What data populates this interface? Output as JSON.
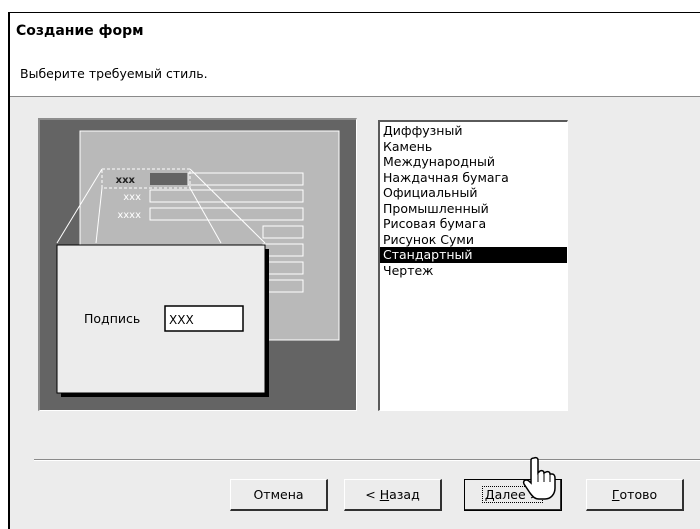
{
  "window": {
    "title": "Создание форм",
    "subtitle": "Выберите требуемый стиль."
  },
  "preview": {
    "field_labels": [
      "xxx",
      "xxx",
      "xxxx"
    ],
    "caption_label": "Подпись",
    "caption_field": "XXX"
  },
  "styles": {
    "items": [
      "Диффузный",
      "Камень",
      "Международный",
      "Наждачная бумага",
      "Официальный",
      "Промышленный",
      "Рисовая бумага",
      "Рисунок Суми",
      "Стандартный",
      "Чертеж"
    ],
    "selected": "Стандартный"
  },
  "buttons": {
    "cancel": "Отмена",
    "back_prefix": "< ",
    "back_hot": "Н",
    "back_rest": "азад",
    "next_hot": "Д",
    "next_rest": "алее >",
    "finish_hot": "Г",
    "finish_rest": "отово"
  }
}
